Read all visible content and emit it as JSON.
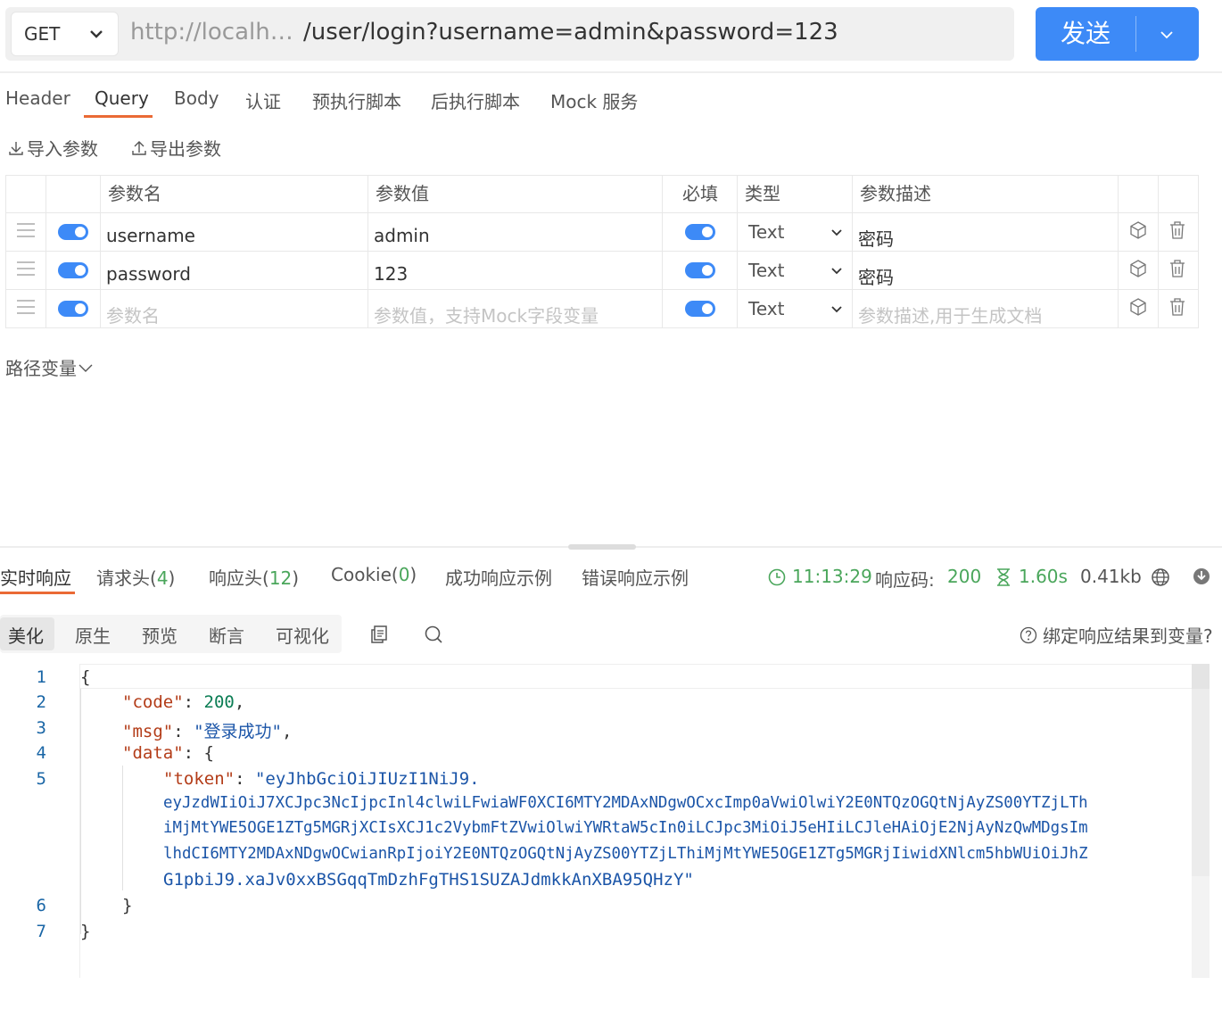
{
  "request": {
    "method": "GET",
    "url_prefix": "http://localh…",
    "url_path": "/user/login?username=admin&password=123",
    "send_label": "发送"
  },
  "tabs": [
    "Header",
    "Query",
    "Body",
    "认证",
    "预执行脚本",
    "后执行脚本",
    "Mock 服务"
  ],
  "active_tab": "Query",
  "actions": {
    "import": "导入参数",
    "export": "导出参数"
  },
  "params_table": {
    "headers": [
      "参数名",
      "参数值",
      "必填",
      "类型",
      "参数描述"
    ],
    "rows": [
      {
        "enabled": true,
        "name": "username",
        "value": "admin",
        "required": true,
        "type": "Text",
        "description": "密码"
      },
      {
        "enabled": true,
        "name": "password",
        "value": "123",
        "required": true,
        "type": "Text",
        "description": "密码"
      },
      {
        "enabled": true,
        "name": "",
        "value": "",
        "required": true,
        "type": "Text",
        "description": ""
      }
    ],
    "placeholders": {
      "name": "参数名",
      "value": "参数值，支持Mock字段变量",
      "description": "参数描述,用于生成文档"
    }
  },
  "path_variables_label": "路径变量",
  "response": {
    "tabs": [
      {
        "label": "实时响应"
      },
      {
        "label": "请求头(",
        "count": "4",
        "suffix": ")"
      },
      {
        "label": "响应头(",
        "count": "12",
        "suffix": ")"
      },
      {
        "label": "Cookie(",
        "count": "0",
        "suffix": ")"
      },
      {
        "label": "成功响应示例"
      },
      {
        "label": "错误响应示例"
      }
    ],
    "time": "11:13:29",
    "status_label": "响应码:",
    "status_code": "200",
    "duration": "1.60s",
    "size": "0.41kb",
    "view_modes": [
      "美化",
      "原生",
      "预览",
      "断言",
      "可视化"
    ],
    "active_view": "美化",
    "bind_label": "绑定响应结果到变量?",
    "line_numbers": [
      "1",
      "2",
      "3",
      "4",
      "5",
      "6",
      "7"
    ],
    "body": {
      "open": "{",
      "code_key": "\"code\"",
      "code_val": "200",
      "msg_key": "\"msg\"",
      "msg_val": "\"登录成功\"",
      "data_key": "\"data\"",
      "token_key": "\"token\"",
      "token_lines": [
        "\"eyJhbGciOiJIUzI1NiJ9.",
        "eyJzdWIiOiJ7XCJpc3NcIjpcInl4clwiLFwiaWF0XCI6MTY2MDAxNDgwOCxcImp0aVwiOlwiY2E0NTQzOGQtNjAyZS00YTZjLTh",
        "iMjMtYWE5OGE1ZTg5MGRjXCIsXCJ1c2VybmFtZVwiOlwiYWRtaW5cIn0iLCJpc3MiOiJ5eHIiLCJleHAiOjE2NjAyNzQwMDgsIm",
        "lhdCI6MTY2MDAxNDgwOCwianRpIjoiY2E0NTQzOGQtNjAyZS00YTZjLThiMjMtYWE5OGE1ZTg5MGRjIiwidXNlcm5hbWUiOiJhZ",
        "G1pbiJ9.xaJv0xxBSGqqTmDzhFgTHS1SUZAJdmkkAnXBA95QHzY\""
      ],
      "data_close": "}",
      "close": "}"
    }
  },
  "colors": {
    "accent": "#3d8af7",
    "tab_underline": "#ea6a35",
    "success": "#4aa65b"
  }
}
